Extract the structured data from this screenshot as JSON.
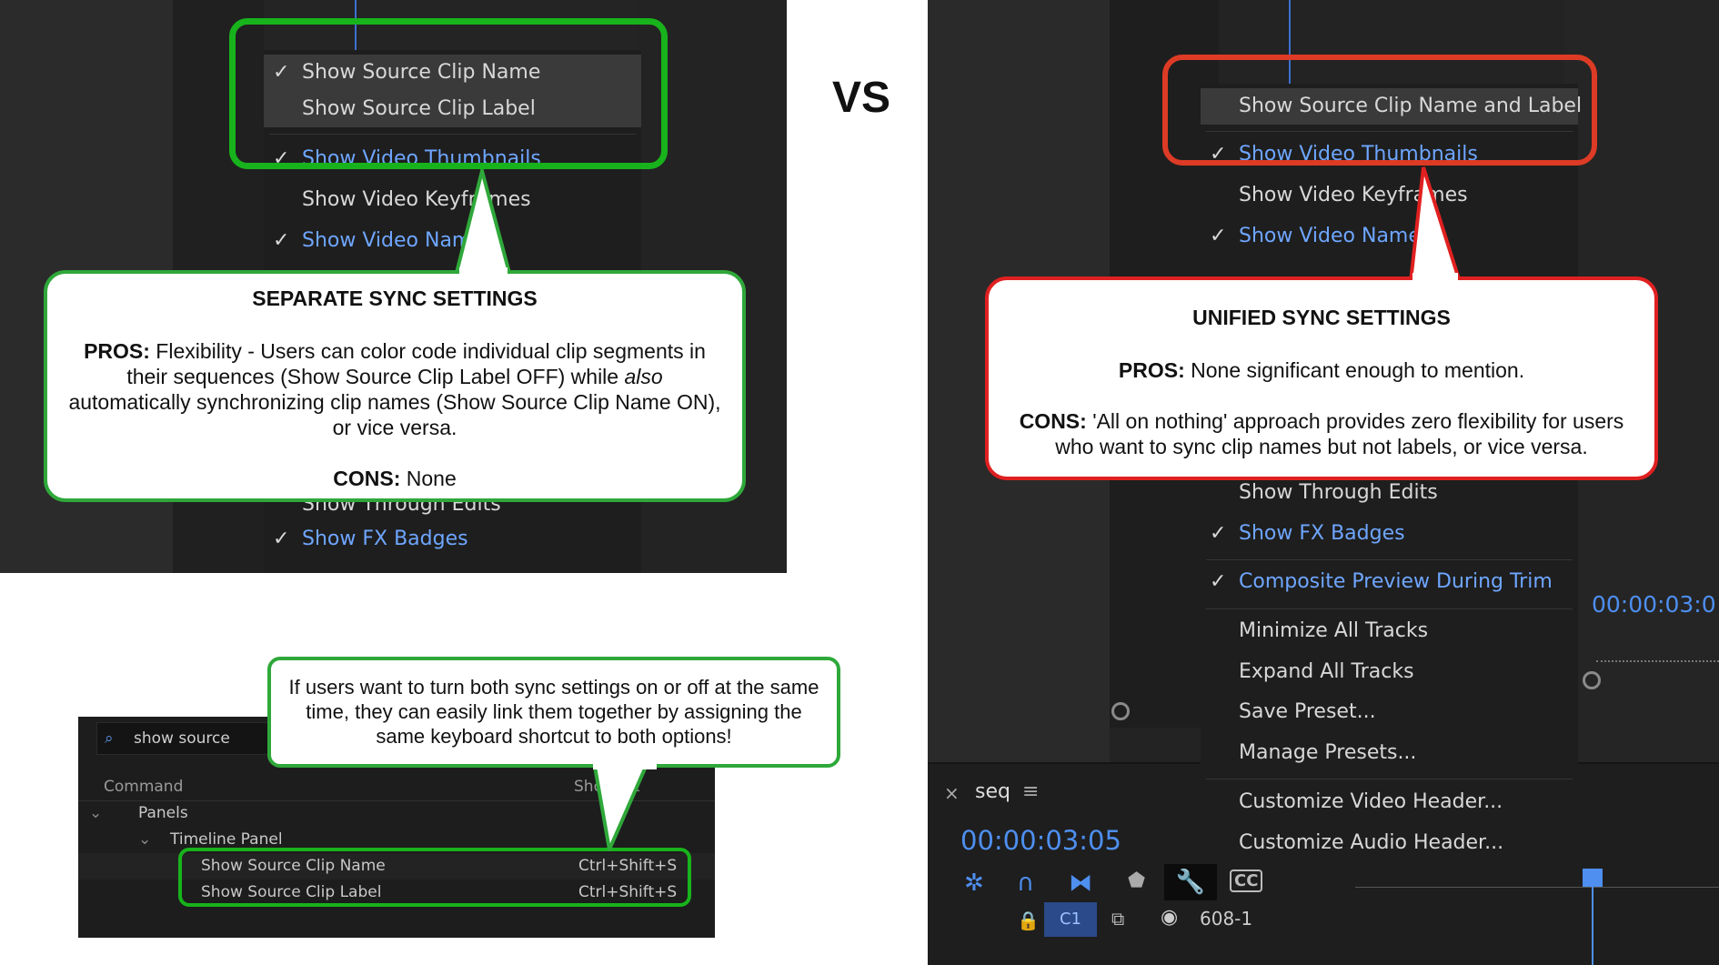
{
  "vs_label": "VS",
  "left_menu": {
    "items": [
      {
        "label": "Show Source Clip Name",
        "checked": true
      },
      {
        "label": "Show Source Clip Label",
        "checked": false
      },
      {
        "label": "Show Video Thumbnails",
        "checked": true
      },
      {
        "label": "Show Video Keyframes",
        "checked": false
      },
      {
        "label": "Show Video Names",
        "checked": true
      },
      {
        "label": "Show Through Edits",
        "checked": false
      },
      {
        "label": "Show FX Badges",
        "checked": true
      }
    ]
  },
  "left_callout": {
    "title": "SEPARATE SYNC SETTINGS",
    "pros_label": "PROS:",
    "pros_text_1": " Flexibility - Users can color code individual clip segments in their sequences (Show Source Clip Label OFF) while ",
    "pros_also": "also",
    "pros_text_2": " automatically synchronizing clip names (Show Source Clip Name ON), or vice versa.",
    "cons_label": "CONS:",
    "cons_text": " None"
  },
  "shortcut_panel": {
    "search_value": "show source",
    "col_command": "Command",
    "col_shortcut": "Shortcut",
    "tree_panels": "Panels",
    "tree_timeline": "Timeline Panel",
    "rows": [
      {
        "command": "Show Source Clip Name",
        "shortcut": "Ctrl+Shift+S"
      },
      {
        "command": "Show Source Clip Label",
        "shortcut": "Ctrl+Shift+S"
      }
    ]
  },
  "bottom_callout": {
    "text": "If users want to turn both sync settings on or off at the same time, they can easily link them together by assigning the same keyboard shortcut to both options!"
  },
  "right_menu": {
    "items": [
      {
        "label": "Show Source Clip Name and Label",
        "checked": false
      },
      {
        "label": "Show Video Thumbnails",
        "checked": true
      },
      {
        "label": "Show Video Keyframes",
        "checked": false
      },
      {
        "label": "Show Video Names",
        "checked": true
      },
      {
        "label": "Show Through Edits",
        "checked": false
      },
      {
        "label": "Show FX Badges",
        "checked": true
      },
      {
        "label": "Composite Preview During Trim",
        "checked": true
      },
      {
        "label": "Minimize All Tracks",
        "checked": false
      },
      {
        "label": "Expand All Tracks",
        "checked": false
      },
      {
        "label": "Save Preset...",
        "checked": false
      },
      {
        "label": "Manage Presets...",
        "checked": false
      },
      {
        "label": "Customize Video Header...",
        "checked": false
      },
      {
        "label": "Customize Audio Header...",
        "checked": false
      }
    ]
  },
  "right_callout": {
    "title": "UNIFIED SYNC SETTINGS",
    "pros_label": "PROS:",
    "pros_text": " None significant enough to mention.",
    "cons_label": "CONS:",
    "cons_text": " 'All on nothing' approach provides zero flexibility for users who want to sync clip names but not labels, or vice versa."
  },
  "timeline": {
    "tab_name": "seq",
    "timecode": "00:00:03:05",
    "timecode_right": "00:00:03:0",
    "track_label": "C1",
    "clip_name": "608-1"
  },
  "colors": {
    "accent_blue": "#6ea6ff",
    "green_frame": "#18b31c",
    "red_frame": "#dd3b25"
  }
}
